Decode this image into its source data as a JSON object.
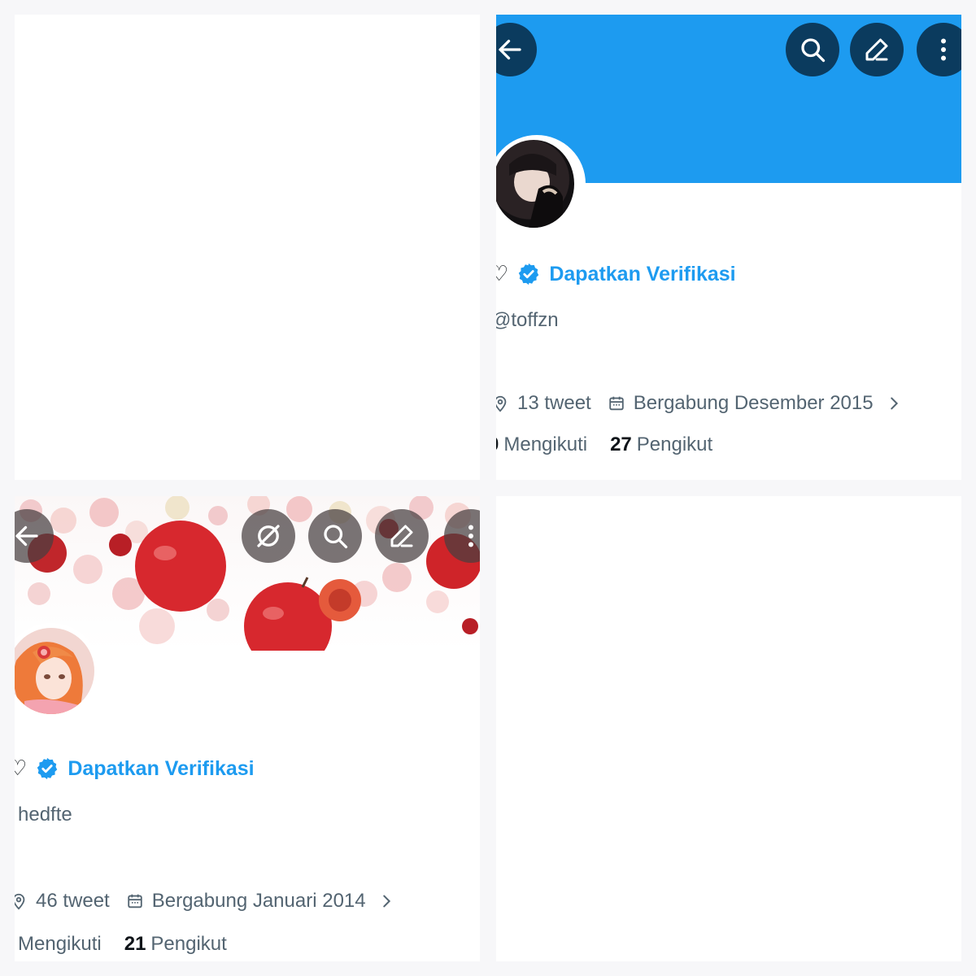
{
  "colors": {
    "accent": "#1d9bf0",
    "button_dark": "#0b3b5e",
    "muted_text": "#536471"
  },
  "profile_top": {
    "icons": [
      "back-arrow-icon",
      "search-icon",
      "edit-pencil-icon",
      "more-vertical-icon"
    ],
    "name_fragment": "♡",
    "verify_label": "Dapatkan Verifikasi",
    "handle": "@toffzn",
    "tweet_count": "13 tweet",
    "joined": "Bergabung Desember 2015",
    "following_label": "Mengikuti",
    "following_fragment": "0",
    "followers_count": "27",
    "followers_label": "Pengikut"
  },
  "profile_bottom": {
    "icons": [
      "back-arrow-icon",
      "no-grok-icon",
      "search-icon",
      "edit-pencil-icon",
      "more-vertical-icon"
    ],
    "name_fragment": "♡",
    "verify_label": "Dapatkan Verifikasi",
    "handle": "hedfte",
    "tweet_count": "46 tweet",
    "joined": "Bergabung Januari 2014",
    "following_label": "Mengikuti",
    "followers_count": "21",
    "followers_label": "Pengikut"
  }
}
